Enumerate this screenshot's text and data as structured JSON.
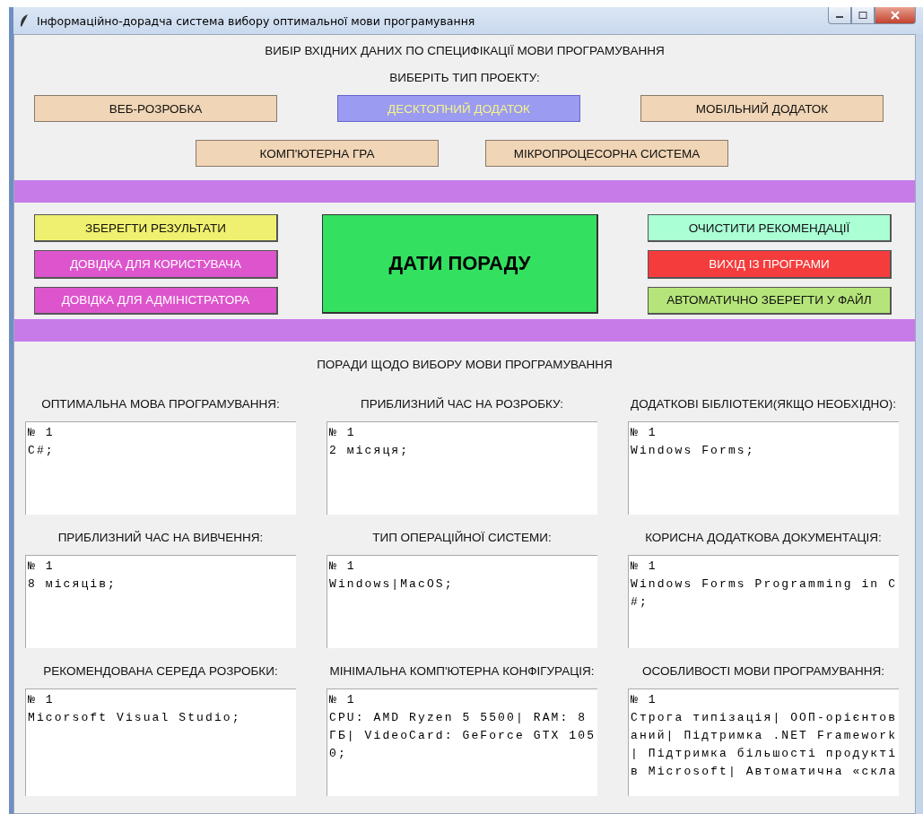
{
  "window": {
    "title": "Інформаційно-дорадча система вибору оптимальної мови програмування"
  },
  "input_section": {
    "heading": "ВИБІР ВХІДНИХ ДАНИХ ПО СПЕЦИФІКАЦІЇ МОВИ ПРОГРАМУВАННЯ",
    "prompt": "ВИБЕРІТЬ ТИП ПРОЕКТУ:",
    "project_types": [
      [
        {
          "label": "ВЕБ-РОЗРОБКА",
          "selected": false
        },
        {
          "label": "ДЕСКТОПНИЙ ДОДАТОК",
          "selected": true
        },
        {
          "label": "МОБІЛЬНИЙ ДОДАТОК",
          "selected": false
        }
      ],
      [
        {
          "label": "КОМП'ЮТЕРНА ГРА",
          "selected": false
        },
        {
          "label": "МІКРОПРОЦЕСОРНА СИСТЕМА",
          "selected": false
        }
      ]
    ]
  },
  "actions": {
    "left": [
      {
        "label": "ЗБЕРЕГТИ РЕЗУЛЬТАТИ",
        "color": "#f0f070"
      },
      {
        "label": "ДОВІДКА ДЛЯ КОРИСТУВАЧА",
        "color": "#dd55cc"
      },
      {
        "label": "ДОВІДКА ДЛЯ АДМІНІСТРАТОРА",
        "color": "#dd55cc"
      }
    ],
    "main": {
      "label": "ДАТИ ПОРАДУ",
      "color": "#33e060"
    },
    "right": [
      {
        "label": "ОЧИСТИТИ РЕКОМЕНДАЦІЇ",
        "color": "#aaffd5"
      },
      {
        "label": "ВИХІД ІЗ ПРОГРАМИ",
        "color": "#f53c3c"
      },
      {
        "label": "АВТОМАТИЧНО ЗБЕРЕГТИ У ФАЙЛ",
        "color": "#b5e57a"
      }
    ]
  },
  "advice_section": {
    "heading": "ПОРАДИ ЩОДО ВИБОРУ МОВИ ПРОГРАМУВАННЯ",
    "fields": [
      {
        "label": "ОПТИМАЛЬНА МОВА ПРОГРАМУВАННЯ:",
        "lines": [
          "№ 1",
          "C#;"
        ]
      },
      {
        "label": "ПРИБЛИЗНИЙ ЧАС НА РОЗРОБКУ:",
        "lines": [
          "№ 1",
          "2 місяця;"
        ]
      },
      {
        "label": "ДОДАТКОВІ БІБЛІОТЕКИ(ЯКЩО НЕОБХІДНО):",
        "lines": [
          "№ 1",
          "Windows Forms;"
        ]
      },
      {
        "label": "ПРИБЛИЗНИЙ ЧАС НА ВИВЧЕННЯ:",
        "lines": [
          "№ 1",
          "8 місяців;"
        ]
      },
      {
        "label": "ТИП ОПЕРАЦІЙНОЇ СИСТЕМИ:",
        "lines": [
          "№ 1",
          "Windows|MacOS;"
        ]
      },
      {
        "label": "КОРИСНА ДОДАТКОВА ДОКУМЕНТАЦІЯ:",
        "lines": [
          "№ 1",
          "Windows Forms Programming in C",
          "#;"
        ]
      },
      {
        "label": "РЕКОМЕНДОВАНА СЕРЕДА РОЗРОБКИ:",
        "lines": [
          "№ 1",
          "Micorsoft Visual Studio;"
        ]
      },
      {
        "label": "МІНІМАЛЬНА КОМП'ЮТЕРНА КОНФІГУРАЦІЯ:",
        "lines": [
          "№ 1",
          "CPU: AMD Ryzen 5 5500| RAM: 8",
          "ГБ| VideoCard: GeForce GTX 105",
          "0;"
        ]
      },
      {
        "label": "ОСОБЛИВОСТІ МОВИ ПРОГРАМУВАННЯ:",
        "lines": [
          "№ 1",
          "Строга типізація| ООП-орієнтов",
          "аний| Підтримка .NET Framework",
          "| Підтримка більшості продукті",
          "в Microsoft| Автоматична «скла"
        ]
      }
    ]
  }
}
